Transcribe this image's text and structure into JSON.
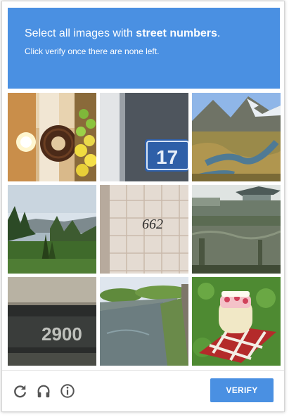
{
  "challenge": {
    "prompt_prefix": "Select all images with ",
    "prompt_target": "street numbers",
    "prompt_suffix": ".",
    "instruction": "Click verify once there are none left."
  },
  "tiles": [
    {
      "row": 1,
      "col": 1,
      "subject": "wreath, lamp and lemons"
    },
    {
      "row": 1,
      "col": 2,
      "subject": "blue number plate",
      "text": "17"
    },
    {
      "row": 1,
      "col": 3,
      "subject": "mountain stream"
    },
    {
      "row": 2,
      "col": 1,
      "subject": "forest and lake"
    },
    {
      "row": 2,
      "col": 2,
      "subject": "tiled wall with number",
      "text": "662"
    },
    {
      "row": 2,
      "col": 3,
      "subject": "pavilion pond"
    },
    {
      "row": 3,
      "col": 1,
      "subject": "blurry number plate",
      "text": "2900"
    },
    {
      "row": 3,
      "col": 2,
      "subject": "canal"
    },
    {
      "row": 3,
      "col": 3,
      "subject": "jar on picnic blanket"
    }
  ],
  "footer": {
    "reload_icon": "reload-icon",
    "audio_icon": "headphones-icon",
    "info_icon": "info-icon",
    "verify_label": "VERIFY"
  },
  "colors": {
    "accent": "#4a90e2",
    "icon": "#555555"
  }
}
